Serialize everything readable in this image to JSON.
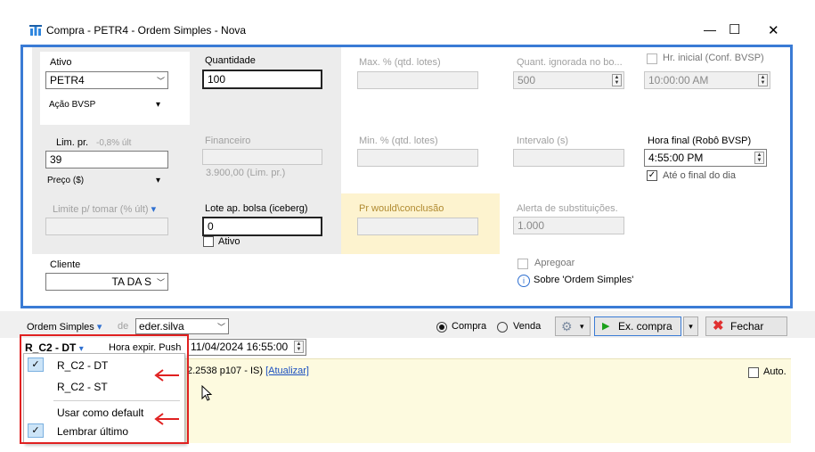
{
  "window": {
    "title": "Compra - PETR4 - Ordem Simples - Nova",
    "minimize": "—",
    "maximize": "☐",
    "close": "✕"
  },
  "form": {
    "ativo": {
      "label": "Ativo",
      "value": "PETR4",
      "tipo": "Ação BVSP"
    },
    "quantidade": {
      "label": "Quantidade",
      "value": "100"
    },
    "max_pct": {
      "label": "Max. % (qtd. lotes)"
    },
    "quant_ignorada": {
      "label": "Quant. ignorada no bo...",
      "value": "500"
    },
    "hr_inicial": {
      "label": "Hr. inicial (Conf. BVSP)",
      "value": "10:00:00 AM"
    },
    "lim_pr": {
      "label": "Lim. pr.",
      "pct": "-0,8% últ",
      "value": "39",
      "tipo": "Preço ($)"
    },
    "financeiro": {
      "label": "Financeiro",
      "value": "3.900,00 (Lim. pr.)"
    },
    "min_pct": {
      "label": "Min. % (qtd. lotes)"
    },
    "intervalo": {
      "label": "Intervalo (s)"
    },
    "hora_final": {
      "label": "Hora final (Robô BVSP)",
      "value": "4:55:00 PM",
      "ate_final": "Até o final do dia"
    },
    "limite_tomar": {
      "label": "Limite p/ tomar (% últ)"
    },
    "lote_ap": {
      "label": "Lote ap. bolsa (iceberg)",
      "value": "0",
      "ativo": "Ativo"
    },
    "pr_would": {
      "label": "Pr would\\conclusão"
    },
    "alerta_subst": {
      "label": "Alerta de substituições.",
      "value": "1.000"
    },
    "cliente": {
      "label": "Cliente",
      "value": "TA DA S"
    },
    "apregoar": {
      "label": "Apregoar"
    },
    "sobre": {
      "label": "Sobre 'Ordem Simples'"
    }
  },
  "bottom": {
    "ordem_simples": "Ordem Simples",
    "de": "de",
    "user": "eder.silva",
    "compra": "Compra",
    "venda": "Venda",
    "ex_compra": "Ex. compra",
    "fechar": "Fechar",
    "strategy": "R_C2 - DT",
    "hora_expir": "Hora expir. Push",
    "hora_expir_value": "11/04/2024 16:55:00",
    "info_text": "2.2538 p107 - IS)",
    "atualizar": "[Atualizar]",
    "auto": "Auto."
  },
  "dropdown": {
    "items": [
      {
        "label": "R_C2 - DT",
        "checked": true
      },
      {
        "label": "R_C2 - ST",
        "checked": false
      },
      {
        "label": "Usar como default",
        "checked": false
      },
      {
        "label": "Lembrar último",
        "checked": true
      }
    ]
  },
  "colors": {
    "accent_border": "#3a7bd5",
    "annotation_red": "#e02020",
    "highlight_yellow": "#fdf3cf",
    "panel_gray": "#f0f0f0"
  }
}
